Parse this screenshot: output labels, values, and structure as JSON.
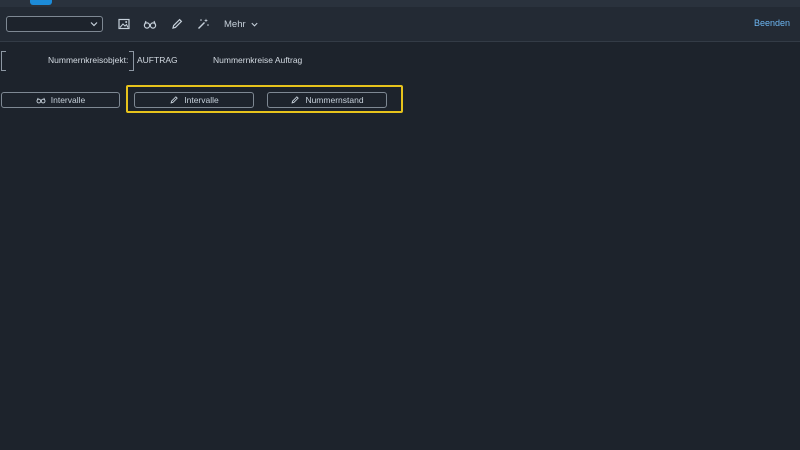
{
  "toolbar": {
    "select": {
      "value": ""
    },
    "icons": [
      "image-icon",
      "glasses-icon",
      "pencil-icon",
      "magic-wand-icon"
    ],
    "more_label": "Mehr",
    "exit_label": "Beenden"
  },
  "header": {
    "object_label": "Nummernkreisobjekt:",
    "object_value": "AUFTRAG",
    "object_description": "Nummernkreise Auftrag"
  },
  "actions": {
    "display_intervals_label": "Intervalle",
    "change_intervals_label": "Intervalle",
    "change_number_status_label": "Nummernstand"
  },
  "colors": {
    "background": "#1d232c",
    "toolbar": "#232a34",
    "highlight": "#e7c31c",
    "link": "#6db6f2"
  }
}
